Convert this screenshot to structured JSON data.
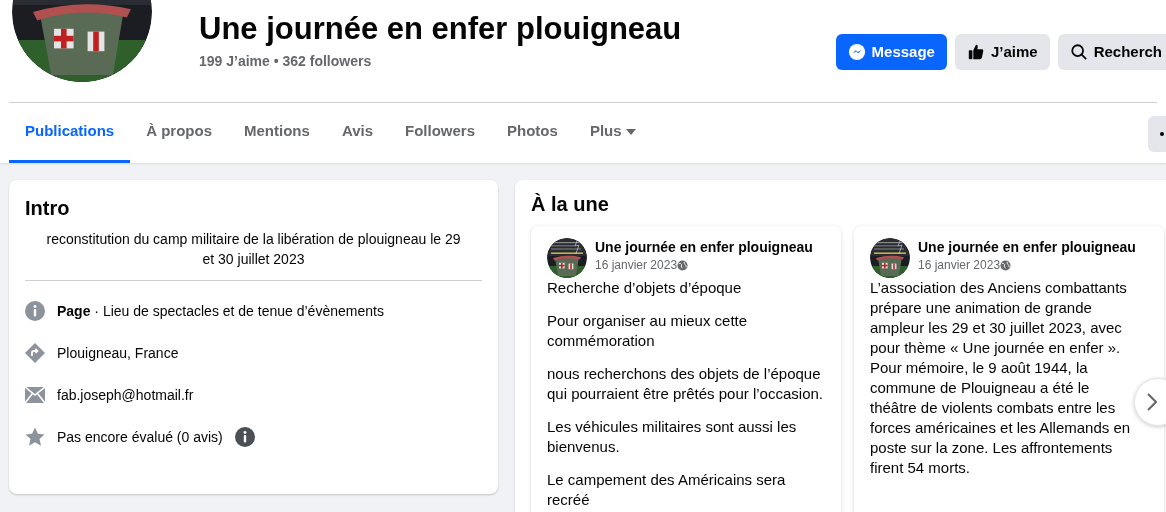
{
  "page": {
    "title": "Une journée en enfer plouigneau",
    "stats": "199 J’aime • 362 followers"
  },
  "actions": [
    {
      "kind": "primary",
      "label": "Message"
    },
    {
      "kind": "secondary",
      "label": "J’aime"
    },
    {
      "kind": "secondary",
      "label": "Recherch"
    }
  ],
  "tabs": [
    {
      "label": "Publications",
      "selected": true
    },
    {
      "label": "À propos",
      "selected": false
    },
    {
      "label": "Mentions",
      "selected": false
    },
    {
      "label": "Avis",
      "selected": false
    },
    {
      "label": "Followers",
      "selected": false
    },
    {
      "label": "Photos",
      "selected": false
    },
    {
      "label": "Plus",
      "selected": false,
      "dropdown": true
    }
  ],
  "intro": {
    "title": "Intro",
    "bio": "reconstitution du camp militaire de la libération de plouigneau le 29 et 30 juillet 2023",
    "items": [
      {
        "text": "**Page** · Lieu de spectacles et de tenue d’évènements"
      },
      {
        "text": "Plouigneau, France"
      },
      {
        "text": "fab.joseph@hotmail.fr"
      },
      {
        "text": "Pas encore évalué (0 avis)",
        "info": true
      }
    ]
  },
  "featured": {
    "title": "À la une",
    "posts": [
      {
        "author": "Une journée en enfer plouigneau",
        "date": "16 janvier 2023",
        "paragraphs": [
          "Recherche d’objets d’époque",
          "Pour organiser au mieux cette commémoration",
          "nous recherchons des objets de l’époque qui pourraient être prêtés pour l’occasion.",
          "Les véhicules militaires sont aussi les bienvenus.",
          "Le campement des Américains sera recréé"
        ]
      },
      {
        "author": "Une journée en enfer plouigneau",
        "date": "16 janvier 2023",
        "paragraphs": [
          "L’association des Anciens combattants prépare une animation de grande ampleur les 29 et 30 juillet 2023, avec pour thème « Une journée en enfer ». Pour mémoire, le 9 août 1944, la commune de Plouigneau a été le théâtre de violents combats entre les forces américaines et les Allemands en poste sur la zone. Les affrontements firent 54 morts."
        ]
      }
    ]
  }
}
